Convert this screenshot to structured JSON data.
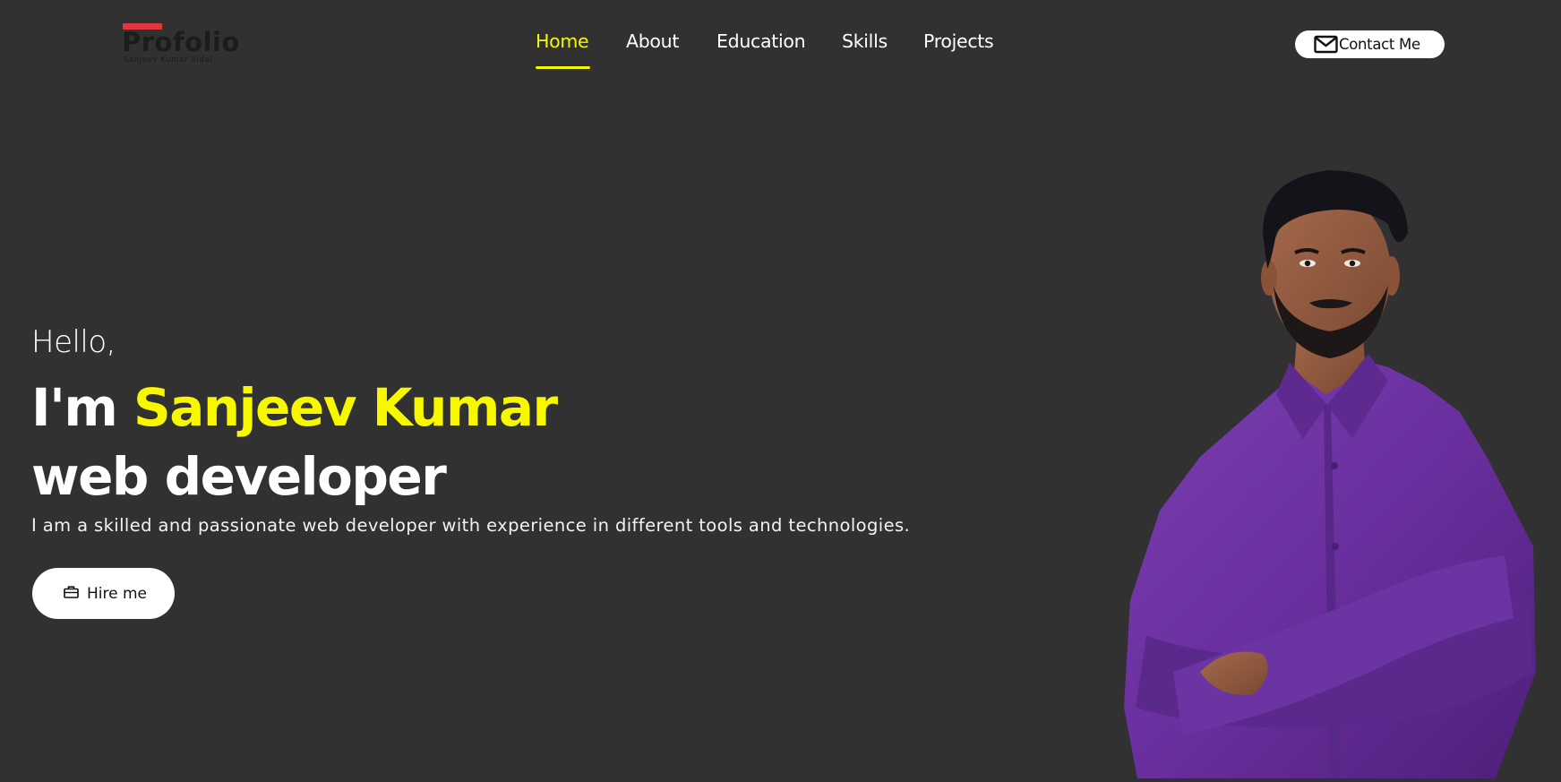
{
  "brand": {
    "logo_text": "Profolio",
    "logo_subtitle": "Sanjeev Kumar Vidal"
  },
  "nav": {
    "items": [
      {
        "label": "Home",
        "active": true
      },
      {
        "label": "About",
        "active": false
      },
      {
        "label": "Education",
        "active": false
      },
      {
        "label": "Skills",
        "active": false
      },
      {
        "label": "Projects",
        "active": false
      }
    ],
    "active_color": "#f7f700"
  },
  "contact": {
    "label": "Contact Me",
    "icon": "mail-icon"
  },
  "hero": {
    "greeting": "Hello,",
    "intro_prefix": "I'm ",
    "name": "Sanjeev Kumar",
    "role": "web developer",
    "description": "I am a skilled and passionate web developer with experience in different tools and technologies.",
    "hire_label": "Hire me",
    "hire_icon": "briefcase-icon",
    "highlight_color": "#f7f700"
  },
  "colors": {
    "background": "#313131",
    "accent": "#f7f700",
    "logo_bar": "#e0383e"
  }
}
